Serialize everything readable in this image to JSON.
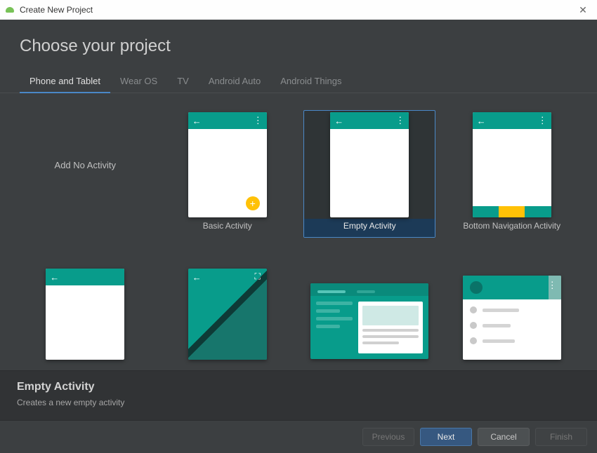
{
  "window": {
    "title": "Create New Project"
  },
  "heading": "Choose your project",
  "tabs": [
    {
      "label": "Phone and Tablet",
      "active": true
    },
    {
      "label": "Wear OS",
      "active": false
    },
    {
      "label": "TV",
      "active": false
    },
    {
      "label": "Android Auto",
      "active": false
    },
    {
      "label": "Android Things",
      "active": false
    }
  ],
  "templates": {
    "no_activity": "Add No Activity",
    "basic": "Basic Activity",
    "empty": "Empty Activity",
    "bottom_nav": "Bottom Navigation Activity"
  },
  "selection": {
    "title": "Empty Activity",
    "description": "Creates a new empty activity"
  },
  "buttons": {
    "previous": "Previous",
    "next": "Next",
    "cancel": "Cancel",
    "finish": "Finish"
  },
  "colors": {
    "teal": "#089c8b",
    "accent": "#ffc107",
    "select_border": "#4a88c7"
  }
}
